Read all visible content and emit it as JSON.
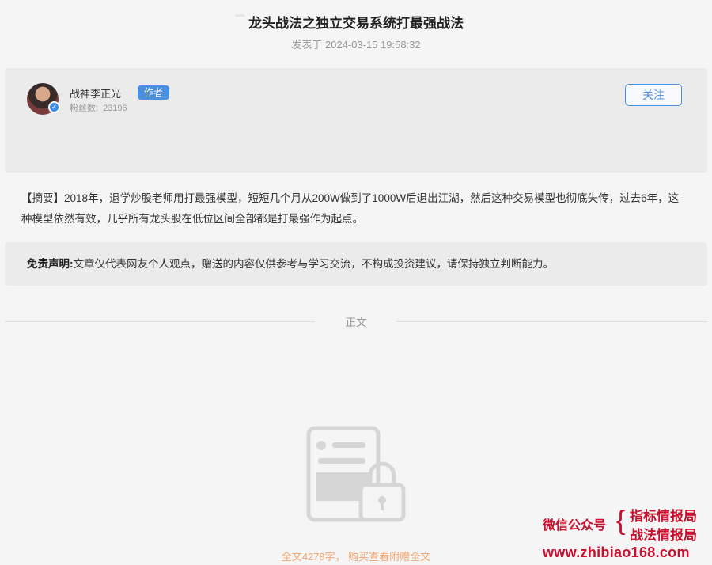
{
  "article": {
    "title": "龙头战法之独立交易系统打最强战法",
    "date": "发表于 2024-03-15 19:58:32"
  },
  "author": {
    "name": "战神李正光",
    "badge": "作者",
    "fans_label": "粉丝数:",
    "fans_count": "23196",
    "follow_label": "关注",
    "verified_mark": "✓"
  },
  "summary": "【摘要】2018年，退学炒股老师用打最强模型，短短几个月从200W做到了1000W后退出江湖，然后这种交易模型也彻底失传，过去6年，这种模型依然有效，几乎所有龙头股在低位区间全部都是打最强作为起点。",
  "disclaimer": {
    "label": "免责声明:",
    "text": "文章仅代表网友个人观点，赠送的内容仅供参考与学习交流，不构成投资建议，请保持独立判断能力。"
  },
  "body_label": "正文",
  "paywall": "全文4278字，  购买查看附赠全文",
  "watermark": {
    "label": "微信公众号",
    "brace": "{",
    "line1": "指标情报局",
    "line2": "战法情报局",
    "url": "www.zhibiao168.com"
  },
  "colors": {
    "accent": "#4a90e2",
    "paywall": "#f3a46c",
    "watermark": "#c8102e"
  }
}
